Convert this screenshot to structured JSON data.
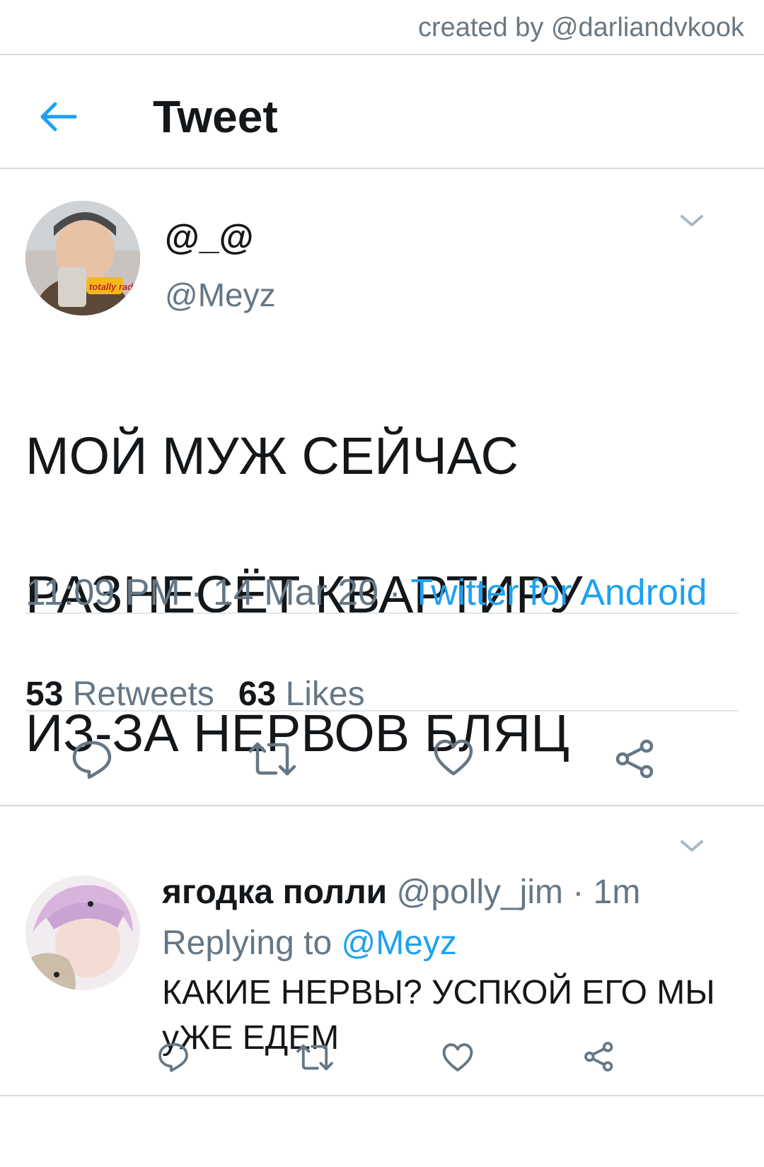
{
  "watermark": "created by @darliandvkook",
  "header": {
    "title": "Tweet",
    "back_icon": "arrow-left-icon"
  },
  "tweet": {
    "display_name": "@_@",
    "handle": "@Meyz",
    "text_lines": [
      "МОЙ МУЖ СЕЙЧАС",
      "РАЗНЕСЁТ КВАРТИРУ",
      "ИЗ-ЗА НЕРВОВ БЛЯЦ"
    ],
    "time": "11:09 PM",
    "date": "14 Mar 20",
    "separator": " · ",
    "source": "Twitter for Android",
    "retweets_count": "53",
    "retweets_label": "Retweets",
    "likes_count": "63",
    "likes_label": "Likes",
    "avatar_sticker": "totally rad!"
  },
  "reply": {
    "display_name": "ягодка полли",
    "handle": "@polly_jim",
    "time": "1m",
    "replying_prefix": "Replying to",
    "replying_to": "@Meyz",
    "text_line1": "КАКИЕ НЕРВЫ? УСПКОЙ ЕГО МЫ",
    "text_line2": "уЖЕ ЕДЕМ"
  },
  "colors": {
    "accent": "#1da1f2",
    "icon": "#657786",
    "text": "#14171a",
    "divider": "#d4d9de"
  }
}
